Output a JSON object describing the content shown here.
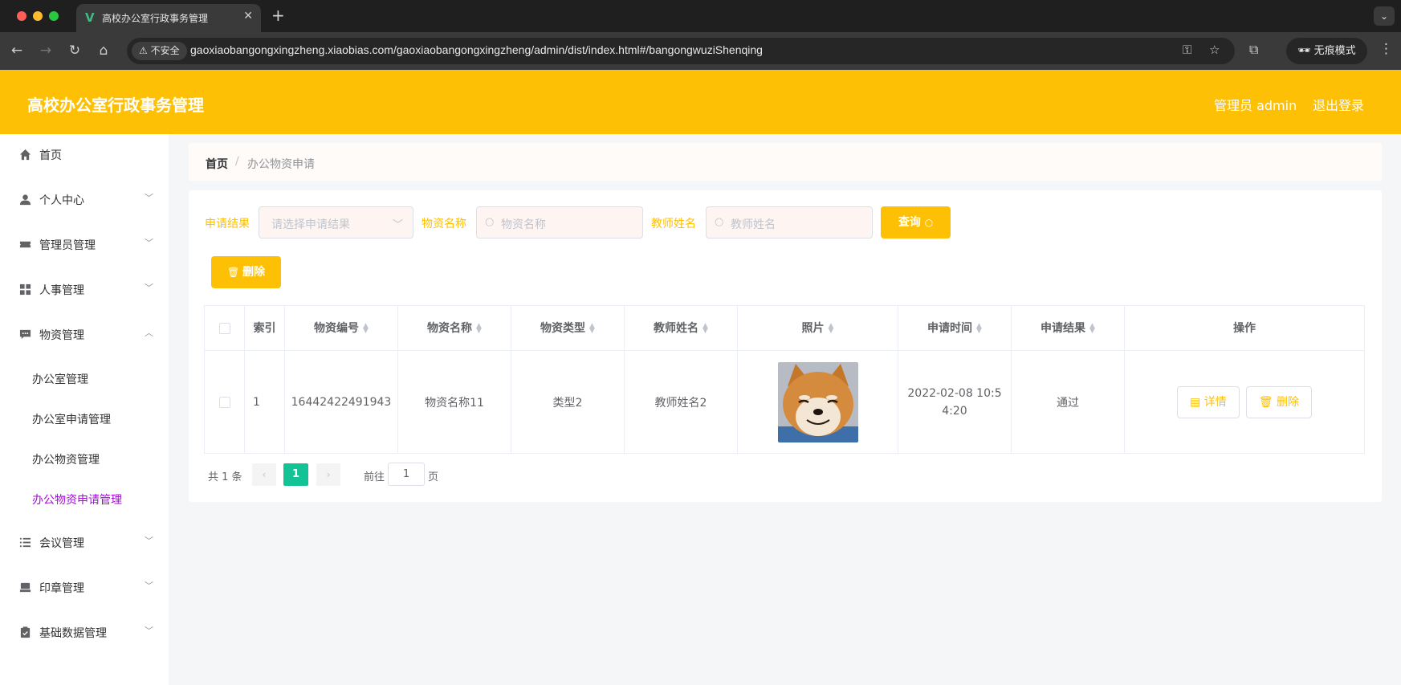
{
  "browser": {
    "tab_title": "高校办公室行政事务管理",
    "tab_favicon": "V",
    "url": "gaoxiaobangongxingzheng.xiaobias.com/gaoxiaobangongxingzheng/admin/dist/index.html#/bangongwuziShenqing",
    "security_label": "不安全",
    "incognito_label": "无痕模式"
  },
  "header": {
    "title": "高校办公室行政事务管理",
    "user": "管理员 admin",
    "logout": "退出登录"
  },
  "sidebar": {
    "items": [
      {
        "label": "首页",
        "icon": "home-icon"
      },
      {
        "label": "个人中心",
        "icon": "user-icon"
      },
      {
        "label": "管理员管理",
        "icon": "ticket-icon"
      },
      {
        "label": "人事管理",
        "icon": "grid-icon"
      },
      {
        "label": "物资管理",
        "icon": "message-icon"
      },
      {
        "label": "会议管理",
        "icon": "list-icon"
      },
      {
        "label": "印章管理",
        "icon": "stamp-icon"
      },
      {
        "label": "基础数据管理",
        "icon": "clipboard-icon"
      }
    ],
    "sub_items": [
      "办公室管理",
      "办公室申请管理",
      "办公物资管理",
      "办公物资申请管理"
    ]
  },
  "breadcrumb": {
    "home": "首页",
    "separator": "/",
    "current": "办公物资申请"
  },
  "filters": {
    "result_label": "申请结果",
    "result_placeholder": "请选择申请结果",
    "name_label": "物资名称",
    "name_placeholder": "物资名称",
    "teacher_label": "教师姓名",
    "teacher_placeholder": "教师姓名",
    "query_button": "查询",
    "delete_button": "删除"
  },
  "table": {
    "columns": [
      "索引",
      "物资编号",
      "物资名称",
      "物资类型",
      "教师姓名",
      "照片",
      "申请时间",
      "申请结果",
      "操作"
    ],
    "rows": [
      {
        "index": "1",
        "code": "16442422491943",
        "name": "物资名称11",
        "type": "类型2",
        "teacher": "教师姓名2",
        "time_line1": "2022-02-08 10:5",
        "time_line2": "4:20",
        "result": "通过",
        "detail_button": "详情",
        "delete_button": "删除"
      }
    ]
  },
  "pagination": {
    "total": "共 1 条",
    "current_page": "1",
    "goto_label": "前往",
    "goto_value": "1",
    "unit": "页"
  },
  "colors": {
    "accent": "#fec005",
    "active_submenu": "#a30bd6",
    "pager_active": "#13c295"
  }
}
